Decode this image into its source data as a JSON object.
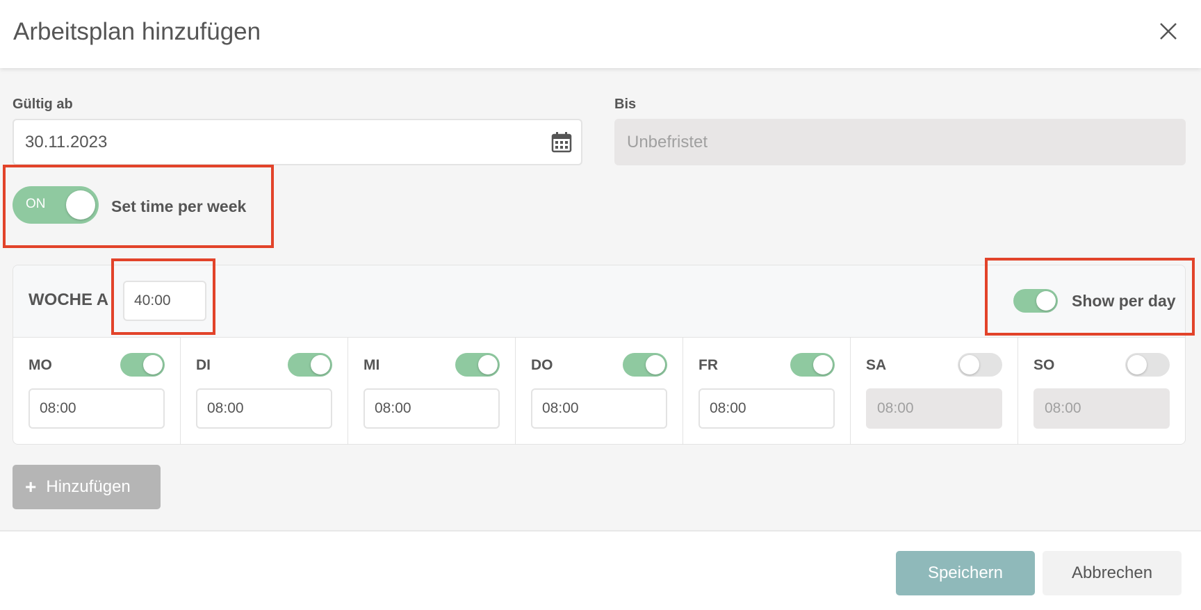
{
  "dialog": {
    "title": "Arbeitsplan hinzufügen"
  },
  "valid_from": {
    "label": "Gültig ab",
    "value": "30.11.2023"
  },
  "until": {
    "label": "Bis",
    "placeholder": "Unbefristet"
  },
  "week_toggle": {
    "state_text": "ON",
    "label": "Set time per week",
    "on": true
  },
  "week": {
    "title": "WOCHE A",
    "hours": "40:00",
    "show_per_day_label": "Show per day",
    "show_per_day_on": true,
    "days": [
      {
        "name": "MO",
        "on": true,
        "value": "08:00"
      },
      {
        "name": "DI",
        "on": true,
        "value": "08:00"
      },
      {
        "name": "MI",
        "on": true,
        "value": "08:00"
      },
      {
        "name": "DO",
        "on": true,
        "value": "08:00"
      },
      {
        "name": "FR",
        "on": true,
        "value": "08:00"
      },
      {
        "name": "SA",
        "on": false,
        "value": "08:00"
      },
      {
        "name": "SO",
        "on": false,
        "value": "08:00"
      }
    ]
  },
  "actions": {
    "add_label": "Hinzufügen",
    "save_label": "Speichern",
    "cancel_label": "Abbrechen"
  },
  "colors": {
    "toggle_on": "#8fc9a0",
    "toggle_off": "#e3e3e3",
    "highlight": "#e2432a",
    "save_button": "#8fb9ba"
  }
}
